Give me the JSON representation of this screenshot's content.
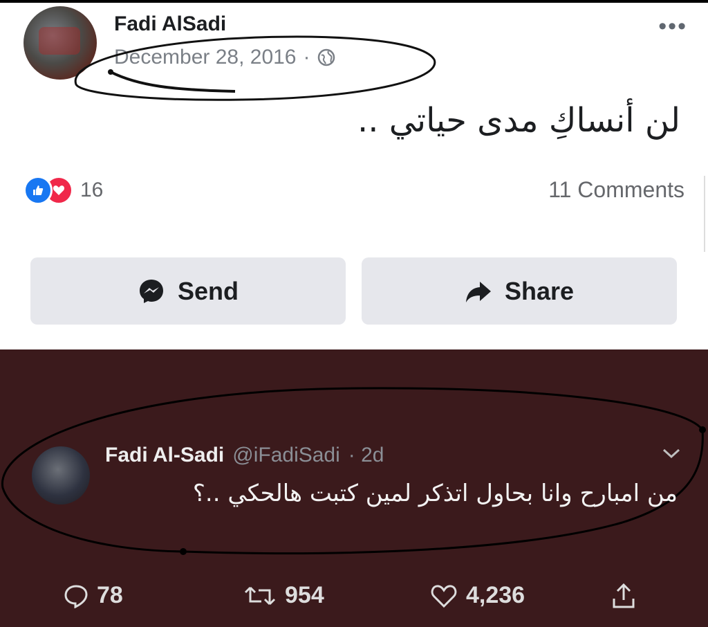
{
  "facebook_post": {
    "author": "Fadi AlSadi",
    "date": "December 28, 2016",
    "separator": "·",
    "more_label": "•••",
    "text": "لن أنساكِ مدى حياتي ..",
    "reaction_count": "16",
    "comments_label": "11 Comments",
    "actions": {
      "send_label": "Send",
      "share_label": "Share"
    },
    "icons": [
      "globe-icon",
      "more-icon",
      "like-reaction-icon",
      "love-reaction-icon",
      "messenger-icon",
      "share-arrow-icon"
    ]
  },
  "tweet": {
    "author": "Fadi Al-Sadi",
    "handle": "@iFadiSadi",
    "time": "· 2d",
    "text": "من امبارح وانا بحاول اتذكر لمين كتبت هالحكي ..؟",
    "reply_count": "78",
    "retweet_count": "954",
    "like_count": "4,236",
    "icons": [
      "chevron-down-icon",
      "reply-icon",
      "retweet-icon",
      "like-icon",
      "share-icon"
    ]
  },
  "colors": {
    "tweet_background": "#3b1a1c",
    "facebook_blue": "#1877f2",
    "love_red": "#f0284a"
  }
}
